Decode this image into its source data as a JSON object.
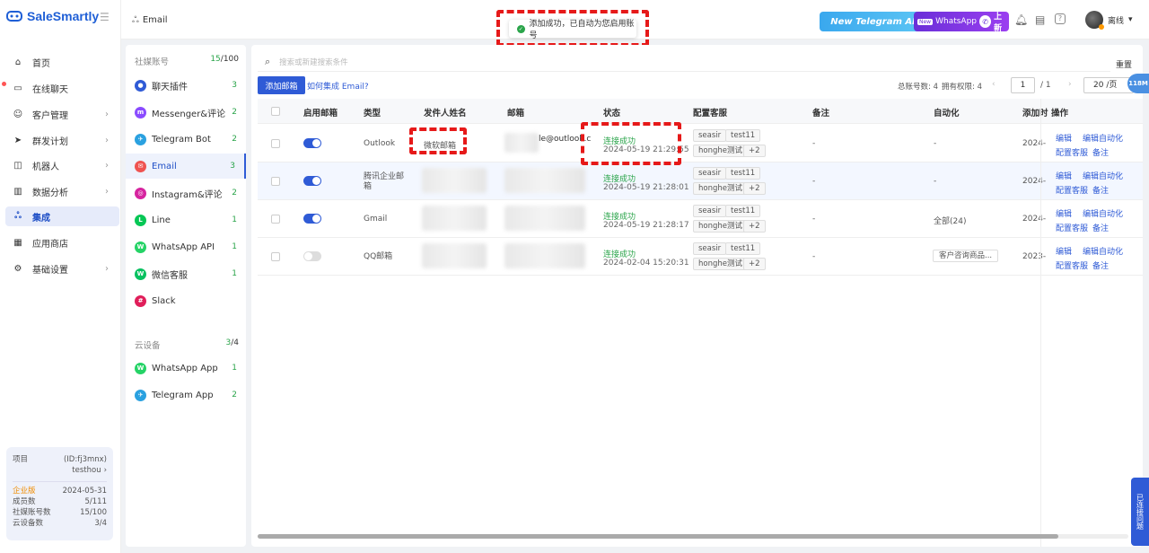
{
  "brand": {
    "name": "SaleSmartly"
  },
  "topbar": {
    "breadcrumb": "Email",
    "toast": "添加成功，已自动为您启用账号",
    "banner_telegram": "New Telegram APP",
    "banner_whatsapp_new": "New",
    "banner_whatsapp": "WhatsApp",
    "banner_whatsapp_suffix": "上新",
    "user_status": "离线"
  },
  "nav": [
    {
      "label": "首页",
      "icon": "home-icon"
    },
    {
      "label": "在线聊天",
      "icon": "chat-icon"
    },
    {
      "label": "客户管理",
      "icon": "customers-icon"
    },
    {
      "label": "群发计划",
      "icon": "send-icon"
    },
    {
      "label": "机器人",
      "icon": "robot-icon"
    },
    {
      "label": "数据分析",
      "icon": "analytics-icon"
    },
    {
      "label": "集成",
      "icon": "integration-icon"
    },
    {
      "label": "应用商店",
      "icon": "apps-icon"
    },
    {
      "label": "基础设置",
      "icon": "settings-icon"
    }
  ],
  "project": {
    "label": "项目",
    "id": "(ID:fj3mnx)",
    "name": "testhou",
    "plan": "企业版",
    "plan_date": "2024-05-31",
    "members_label": "成员数",
    "members": "5/111",
    "social_label": "社媒账号数",
    "social": "15/100",
    "cloud_label": "云设备数",
    "cloud": "3/4"
  },
  "accounts": {
    "section1": "社媒账号",
    "section1_count": "15",
    "section1_total": "/100",
    "items": [
      {
        "label": "聊天插件",
        "count": "3",
        "color": "#2f5bd6",
        "glyph": "●"
      },
      {
        "label": "Messenger&评论",
        "count": "2",
        "color": "#8a4bff",
        "glyph": "m"
      },
      {
        "label": "Telegram Bot",
        "count": "2",
        "color": "#2aa1e0",
        "glyph": "✈"
      },
      {
        "label": "Email",
        "count": "3",
        "color": "#ef5350",
        "glyph": "✉"
      },
      {
        "label": "Instagram&评论",
        "count": "2",
        "color": "#d6249f",
        "glyph": "◎"
      },
      {
        "label": "Line",
        "count": "1",
        "color": "#06c755",
        "glyph": "L"
      },
      {
        "label": "WhatsApp API",
        "count": "1",
        "color": "#25d366",
        "glyph": "W"
      },
      {
        "label": "微信客服",
        "count": "1",
        "color": "#07c160",
        "glyph": "W"
      },
      {
        "label": "Slack",
        "count": "",
        "color": "#e01e5a",
        "glyph": "#"
      }
    ],
    "section2": "云设备",
    "section2_count": "3",
    "section2_total": "/4",
    "cloud": [
      {
        "label": "WhatsApp App",
        "count": "1",
        "color": "#25d366",
        "glyph": "W"
      },
      {
        "label": "Telegram App",
        "count": "2",
        "color": "#2aa1e0",
        "glyph": "✈"
      }
    ]
  },
  "toolbar": {
    "search_placeholder": "搜索或新建搜索条件",
    "reset": "重置",
    "add_button": "添加邮箱",
    "how_link": "如何集成 Email?",
    "total_label": "总账号数: 4",
    "perm_label": "拥有权限: 4",
    "page": "1",
    "page_total": "/ 1",
    "page_size": "20 /页"
  },
  "table": {
    "headers": [
      "启用邮箱",
      "类型",
      "发件人姓名",
      "邮箱",
      "状态",
      "配置客服",
      "备注",
      "自动化",
      "添加时",
      "操作"
    ],
    "rows": [
      {
        "type": "Outlook",
        "sender": "微软邮箱",
        "email": "le@outlook.c",
        "status": "连接成功",
        "time": "2024-05-19 21:29:55",
        "tags": [
          "seasir",
          "test11",
          "honghe测试",
          "+2"
        ],
        "note": "-",
        "auto": "-",
        "added": "2024-",
        "on": true
      },
      {
        "type": "腾讯企业邮箱",
        "sender": "",
        "email": "",
        "status": "连接成功",
        "time": "2024-05-19 21:28:01",
        "tags": [
          "seasir",
          "test11",
          "honghe测试",
          "+2"
        ],
        "note": "-",
        "auto": "-",
        "added": "2024-",
        "on": true
      },
      {
        "type": "Gmail",
        "sender": "",
        "email": "",
        "status": "连接成功",
        "time": "2024-05-19 21:28:17",
        "tags": [
          "seasir",
          "test11",
          "honghe测试",
          "+2"
        ],
        "note": "-",
        "auto": "全部(24)",
        "added": "2024-",
        "on": true
      },
      {
        "type": "QQ邮箱",
        "sender": "",
        "email": "",
        "status": "连接成功",
        "time": "2024-02-04 15:20:31",
        "tags": [
          "seasir",
          "test11",
          "honghe测试",
          "+2"
        ],
        "note": "-",
        "auto": "客户咨询商品...",
        "added": "2023-",
        "on": false
      }
    ],
    "actions": [
      "编辑",
      "编辑自动化",
      "配置客服",
      "备注"
    ]
  },
  "float": {
    "badge": "118M",
    "feedback": "已连接问题"
  }
}
